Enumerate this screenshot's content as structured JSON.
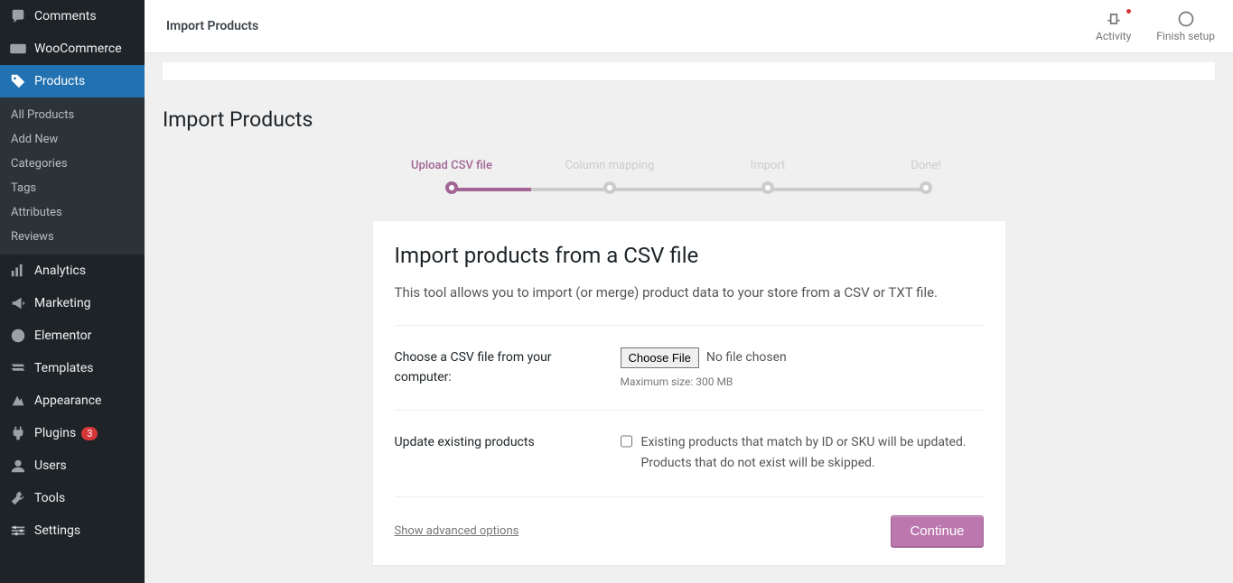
{
  "sidebar": {
    "items": [
      {
        "label": "Comments"
      },
      {
        "label": "WooCommerce"
      },
      {
        "label": "Products"
      },
      {
        "label": "Analytics"
      },
      {
        "label": "Marketing"
      },
      {
        "label": "Elementor"
      },
      {
        "label": "Templates"
      },
      {
        "label": "Appearance"
      },
      {
        "label": "Plugins",
        "badge": "3"
      },
      {
        "label": "Users"
      },
      {
        "label": "Tools"
      },
      {
        "label": "Settings"
      }
    ],
    "sub": [
      {
        "label": "All Products"
      },
      {
        "label": "Add New"
      },
      {
        "label": "Categories"
      },
      {
        "label": "Tags"
      },
      {
        "label": "Attributes"
      },
      {
        "label": "Reviews"
      }
    ]
  },
  "topbar": {
    "title": "Import Products",
    "activity": "Activity",
    "finish": "Finish setup"
  },
  "page": {
    "title": "Import Products"
  },
  "steps": [
    {
      "label": "Upload CSV file"
    },
    {
      "label": "Column mapping"
    },
    {
      "label": "Import"
    },
    {
      "label": "Done!"
    }
  ],
  "card": {
    "title": "Import products from a CSV file",
    "desc": "This tool allows you to import (or merge) product data to your store from a CSV or TXT file.",
    "choose_label": "Choose a CSV file from your computer:",
    "choose_btn": "Choose File",
    "no_file": "No file chosen",
    "max_size": "Maximum size: 300 MB",
    "update_label": "Update existing products",
    "update_desc": "Existing products that match by ID or SKU will be updated. Products that do not exist will be skipped.",
    "advanced": "Show advanced options",
    "continue": "Continue"
  }
}
